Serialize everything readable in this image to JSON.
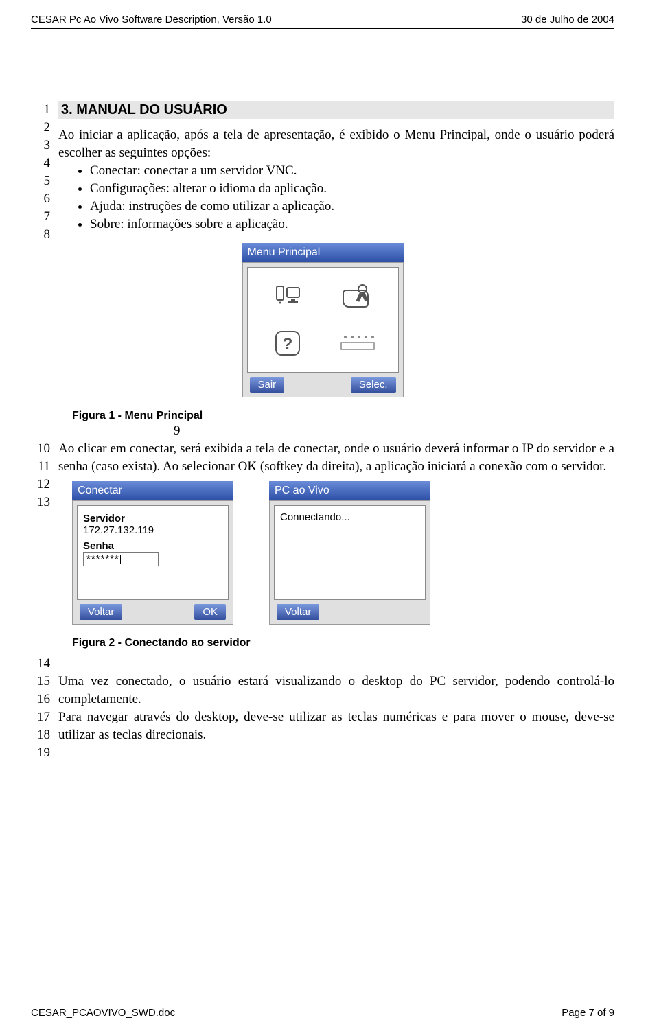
{
  "header": {
    "left": "CESAR Pc Ao Vivo Software Description, Versão 1.0",
    "right": "30 de Julho de 2004"
  },
  "section": {
    "number_title": "3.  MANUAL DO USUÁRIO"
  },
  "line_numbers_top": [
    "1",
    "2",
    "3",
    "4",
    "5",
    "6",
    "7",
    "8"
  ],
  "intro_para": "Ao iniciar a aplicação, após a tela de apresentação, é exibido o Menu Principal, onde o usuário poderá escolher as seguintes opções:",
  "bullets": [
    "Conectar: conectar a um servidor VNC.",
    "Configurações: alterar o idioma da aplicação.",
    "Ajuda: instruções de como utilizar a aplicação.",
    "Sobre: informações sobre a aplicação."
  ],
  "fig1": {
    "caption": "Figura 1 - Menu Principal",
    "title": "Menu Principal",
    "soft_left": "Sair",
    "soft_right": "Selec."
  },
  "after_fig1_number": "9",
  "line_numbers_mid": [
    "10",
    "11",
    "12",
    "13"
  ],
  "mid_para": "Ao clicar em conectar, será exibida a tela de conectar, onde o usuário deverá informar o IP do servidor e a senha (caso exista). Ao selecionar OK (softkey da direita), a aplicação iniciará a conexão com o servidor.",
  "fig2": {
    "caption": "Figura 2 - Conectando ao servidor",
    "left": {
      "title": "Conectar",
      "servidor_label": "Servidor",
      "servidor_value": "172.27.132.119",
      "senha_label": "Senha",
      "senha_value": "*******",
      "soft_left": "Voltar",
      "soft_right": "OK"
    },
    "right": {
      "title": "PC ao Vivo",
      "body": "Connectando...",
      "soft_left": "Voltar"
    }
  },
  "line_numbers_end": [
    "14",
    "15",
    "16",
    "17",
    "18",
    "19"
  ],
  "end_para1": "Uma vez conectado, o usuário estará visualizando o desktop do PC servidor, podendo controlá-lo completamente.",
  "end_para2": "Para navegar através do desktop, deve-se utilizar as teclas numéricas e para mover o mouse, deve-se utilizar as teclas direcionais.",
  "footer": {
    "left": "CESAR_PCAOVIVO_SWD.doc",
    "right": "Page 7 of 9"
  }
}
